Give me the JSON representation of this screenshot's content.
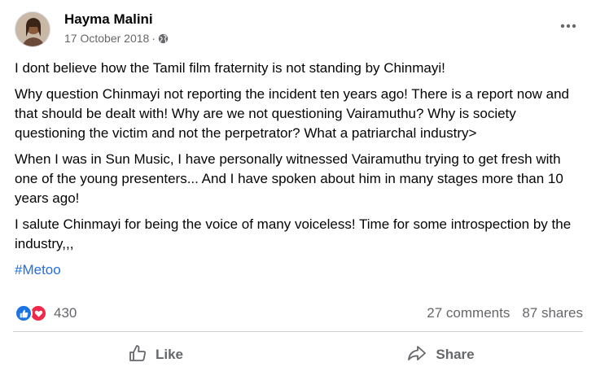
{
  "post": {
    "author": "Hayma Malini",
    "date": "17 October 2018",
    "separator": "·",
    "privacy_icon": "globe-icon",
    "paragraphs": [
      "I dont believe how the Tamil film fraternity is not standing by Chinmayi!",
      "Why question Chinmayi not reporting the incident ten years ago! There is a report now and that should be dealt with! Why are we not questioning Vairamuthu? Why is society questioning the victim and not the perpetrator? What a patriarchal industry>",
      "When I was in Sun Music, I have personally witnessed Vairamuthu trying to get fresh with one of the young presenters... And I have spoken about him in many stages more than 10 years ago!",
      "I salute Chinmayi for being the voice of many voiceless! Time for some introspection by the industry,,,"
    ],
    "hashtag": "#Metoo"
  },
  "stats": {
    "reaction_icons": [
      "like-icon",
      "love-icon"
    ],
    "reaction_count": "430",
    "comments": "27 comments",
    "shares": "87 shares"
  },
  "actions": {
    "like_label": "Like",
    "share_label": "Share"
  },
  "colors": {
    "link": "#216fdb",
    "secondary_text": "#65676b",
    "like_blue": "#1b74e4",
    "love_red": "#f02849"
  }
}
